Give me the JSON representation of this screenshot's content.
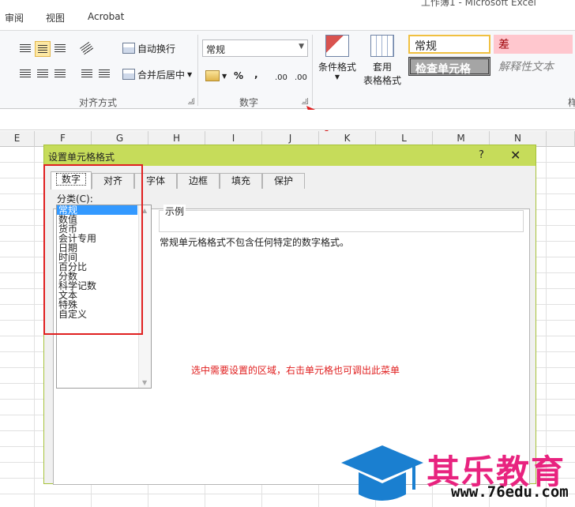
{
  "ribbon": {
    "tabs": [
      "审阅",
      "视图",
      "Acrobat"
    ],
    "title_fragment": "工作簿1 - Microsoft Excel",
    "align_group": {
      "label": "对齐方式",
      "wrap_text": "自动换行",
      "merge_center": "合并后居中"
    },
    "number_group": {
      "label": "数字",
      "format_value": "常规",
      "percent": "%",
      "comma": ",",
      "inc_decimal": ".00",
      "dec_decimal": ".00"
    },
    "styles_group": {
      "conditional_format": "条件格式",
      "format_as_table_line1": "套用",
      "format_as_table_line2": "表格格式",
      "style_normal": "常规",
      "style_bad": "差",
      "style_check_cell": "检查单元格",
      "style_explanatory": "解释性文本",
      "cut_label": "样"
    }
  },
  "grid": {
    "columns": [
      "E",
      "F",
      "G",
      "H",
      "I",
      "J",
      "K",
      "L",
      "M",
      "N"
    ]
  },
  "dialog": {
    "title": "设置单元格格式",
    "help": "?",
    "close": "✕",
    "tabs": [
      "数字",
      "对齐",
      "字体",
      "边框",
      "填充",
      "保护"
    ],
    "category_label": "分类(C):",
    "categories": [
      "常规",
      "数值",
      "货币",
      "会计专用",
      "日期",
      "时间",
      "百分比",
      "分数",
      "科学记数",
      "文本",
      "特殊",
      "自定义"
    ],
    "sample_label": "示例",
    "description": "常规单元格格式不包含任何特定的数字格式。",
    "annotation": "选中需要设置的区域，右击单元格也可调出此菜单"
  },
  "watermark": {
    "name": "其乐教育",
    "url": "www.76edu.com"
  },
  "colors": {
    "dialog_title_bar": "#c6dc5a",
    "highlight_red": "#e02020",
    "watermark_pink": "#e8237f",
    "watermark_blue": "#1a7fd0"
  }
}
